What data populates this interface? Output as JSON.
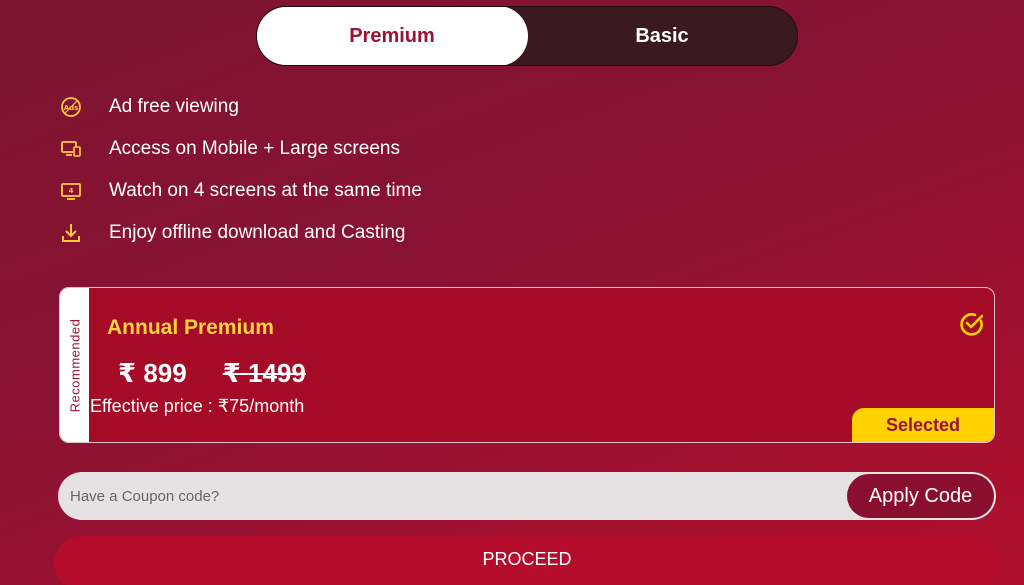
{
  "tabs": [
    {
      "label": "Premium",
      "active": true
    },
    {
      "label": "Basic",
      "active": false
    }
  ],
  "features": [
    {
      "icon": "ad-free-icon",
      "text": "Ad free viewing"
    },
    {
      "icon": "multi-device-icon",
      "text": "Access on Mobile + Large screens"
    },
    {
      "icon": "screens-icon",
      "text": "Watch on 4 screens at the same time"
    },
    {
      "icon": "download-icon",
      "text": "Enjoy offline download and Casting"
    }
  ],
  "plan": {
    "recommended_label": "Recommended",
    "title": "Annual Premium",
    "price": "₹ 899",
    "old_price": "₹ 1499",
    "effective": "Effective price : ₹75/month",
    "selected_label": "Selected"
  },
  "coupon": {
    "placeholder": "Have a Coupon code?",
    "apply_label": "Apply Code"
  },
  "proceed_label": "PROCEED",
  "colors": {
    "accent_yellow": "#ffd23f",
    "brand_red": "#9c1237",
    "card_bg": "#a50a27"
  }
}
